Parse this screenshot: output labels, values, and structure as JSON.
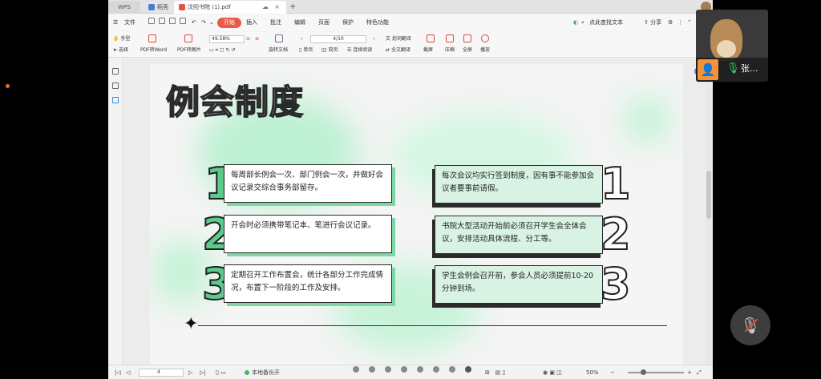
{
  "tabs": {
    "wps": "WPS",
    "home": "稻壳",
    "document": "汶阳书院 (1).pdf",
    "plus": "+"
  },
  "menu": {
    "file": "文件",
    "items": [
      "开始",
      "插入",
      "批注",
      "编辑",
      "页面",
      "保护",
      "特色功能"
    ],
    "search": "点此查找文本",
    "share": "分享"
  },
  "ribbon": {
    "hand": "手型",
    "select": "选择",
    "pdf_to_word": "PDF转Word",
    "pdf_to_image": "PDF转图片",
    "zoom": "49.58%",
    "rotate": "旋转文档",
    "single": "单页",
    "double": "双页",
    "continuous": "连续阅读",
    "page": "4/10",
    "word_translate": "划词翻译",
    "full_translate": "全文翻译",
    "screenshot": "截屏",
    "compress": "压缩",
    "fullscreen": "全屏",
    "play": "播放"
  },
  "slide": {
    "title": "例会制度",
    "left_items": [
      {
        "num": "1",
        "text": "每周部长例会一次、部门例会一次，并做好会议记录交综合事务部留存。"
      },
      {
        "num": "2",
        "text": "开会时必须携带笔记本、笔进行会议记录。"
      },
      {
        "num": "3",
        "text": "定期召开工作布置会，统计各部分工作完成情况，布置下一阶段的工作及安排。"
      }
    ],
    "right_items": [
      {
        "num": "1",
        "text": "每次会议均实行签到制度，因有事不能参加会议者要事前请假。"
      },
      {
        "num": "2",
        "text": "书院大型活动开始前必须召开学生会全体会议，安排活动具体流程、分工等。"
      },
      {
        "num": "3",
        "text": "学生会例会召开前，参会人员必须提前10-20分钟到场。"
      }
    ],
    "colors": {
      "accent_green": "#5cc98d",
      "card_green": "#d8f3e3"
    }
  },
  "status": {
    "page_current": "4",
    "backup": "本地备份开",
    "zoom": "50%"
  },
  "call": {
    "name": "张...",
    "user_icon": "user-icon",
    "mic_icon": "microphone-icon",
    "mute_icon": "muted-microphone-icon"
  }
}
